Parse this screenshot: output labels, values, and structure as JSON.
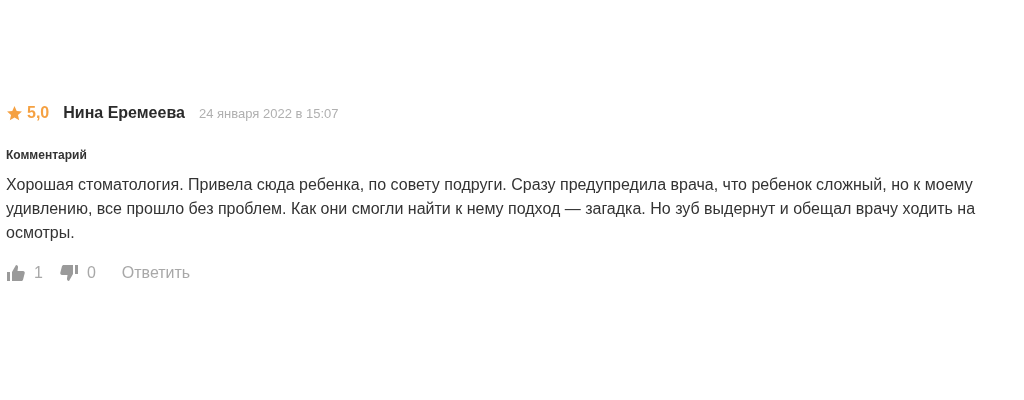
{
  "review": {
    "rating": "5,0",
    "author": "Нина Еремеева",
    "date": "24 января 2022 в 15:07",
    "section_label": "Комментарий",
    "text": "Хорошая стоматология. Привела сюда ребенка, по совету подруги. Сразу предупредила врача, что ребенок сложный, но к моему удивлению, все прошло без проблем. Как они смогли найти к нему подход — загадка. Но зуб выдернут и обещал врачу ходить на осмотры.",
    "likes": "1",
    "dislikes": "0",
    "reply": "Ответить"
  }
}
